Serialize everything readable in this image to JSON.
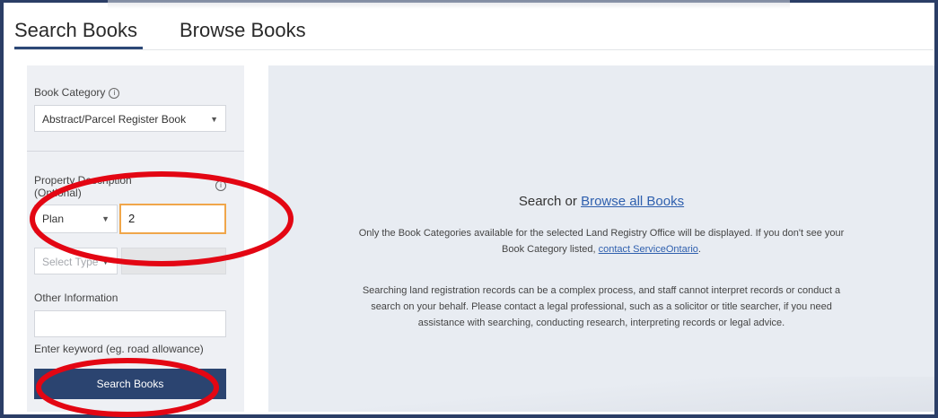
{
  "tabs": [
    {
      "label": "Search Books",
      "selected": true
    },
    {
      "label": "Browse Books",
      "selected": false
    }
  ],
  "sidebar": {
    "book_category": {
      "label": "Book Category",
      "info_icon": "ⓘ",
      "value": "Abstract/Parcel Register Book"
    },
    "property_description": {
      "label_line1": "Property Description",
      "label_line2": "(Optional)",
      "info_icon": "ⓘ",
      "type_value": "Plan",
      "number_value": "2",
      "select_type_placeholder": "Select Type"
    },
    "other_information": {
      "label": "Other Information",
      "value": "",
      "hint": "Enter keyword (eg. road allowance)"
    },
    "search_button_label": "Search Books"
  },
  "main": {
    "headline_prefix": "Search or ",
    "headline_link": "Browse all Books",
    "paragraph1_text": "Only the Book Categories available for the selected Land Registry Office will be displayed. If you don't see your Book Category listed, ",
    "paragraph1_link": "contact ServiceOntario",
    "paragraph1_end": ".",
    "paragraph2": "Searching land registration records can be a complex process, and staff cannot interpret records or conduct a search on your behalf. Please contact a legal professional, such as a solicitor or title searcher, if you need assistance with searching, conducting research, interpreting records or legal advice."
  },
  "colors": {
    "accent": "#2b4470",
    "annotation": "#e30613",
    "link": "#2e5fae",
    "focus": "#f0a64a"
  },
  "icons": {
    "info": "info-icon",
    "dropdown": "chevron-down-icon"
  }
}
